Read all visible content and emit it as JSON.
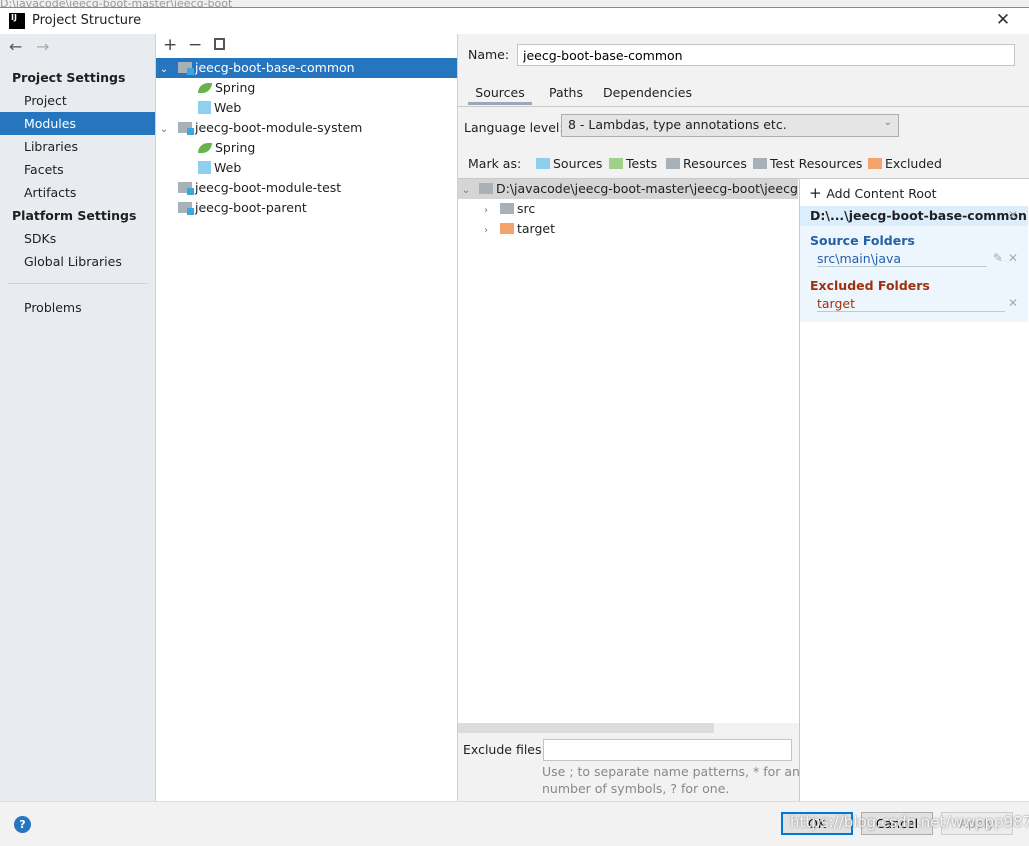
{
  "background_text": "D:\\javacode\\jeecg-boot-master\\jeecg-boot",
  "window": {
    "title": "Project Structure",
    "icon": "intellij-icon"
  },
  "sidebar": {
    "project_settings": "Project Settings",
    "items": [
      {
        "label": "Project"
      },
      {
        "label": "Modules",
        "selected": true
      },
      {
        "label": "Libraries"
      },
      {
        "label": "Facets"
      },
      {
        "label": "Artifacts"
      }
    ],
    "platform_settings": "Platform Settings",
    "platform_items": [
      {
        "label": "SDKs"
      },
      {
        "label": "Global Libraries"
      }
    ],
    "problems": "Problems"
  },
  "modules": [
    {
      "label": "jeecg-boot-base-common",
      "selected": true,
      "children": [
        {
          "label": "Spring",
          "icon": "spring-icon"
        },
        {
          "label": "Web",
          "icon": "web-icon"
        }
      ]
    },
    {
      "label": "jeecg-boot-module-system",
      "children": [
        {
          "label": "Spring",
          "icon": "spring-icon"
        },
        {
          "label": "Web",
          "icon": "web-icon"
        }
      ]
    },
    {
      "label": "jeecg-boot-module-test"
    },
    {
      "label": "jeecg-boot-parent"
    }
  ],
  "detail": {
    "name_label": "Name:",
    "name_value": "jeecg-boot-base-common",
    "tabs": [
      {
        "label": "Sources",
        "active": true
      },
      {
        "label": "Paths"
      },
      {
        "label": "Dependencies"
      }
    ],
    "language_level_label": "Language level:",
    "language_level": "8 - Lambdas, type annotations etc.",
    "mark_as": "Mark as:",
    "marks": [
      {
        "label": "Sources",
        "color": "#8fcfee"
      },
      {
        "label": "Tests",
        "color": "#9fd18b"
      },
      {
        "label": "Resources",
        "color": "#a9b1b8"
      },
      {
        "label": "Test Resources",
        "color": "#a9b1b8"
      },
      {
        "label": "Excluded",
        "color": "#f4a36f"
      }
    ],
    "root_path": "D:\\javacode\\jeecg-boot-master\\jeecg-boot\\jeecg-b",
    "folders": [
      {
        "label": "src",
        "color": "#a9b1b8"
      },
      {
        "label": "target",
        "color": "#f4a36f"
      }
    ],
    "add_content_root": "Add Content Root",
    "content_root": "D:\\...\\jeecg-boot-base-common",
    "source_folders_label": "Source Folders",
    "source_folder": "src\\main\\java",
    "excluded_folders_label": "Excluded Folders",
    "excluded_folder": "target",
    "exclude_files_label": "Exclude files:",
    "exclude_files_value": "",
    "hint1": "Use ; to separate name patterns, * for any",
    "hint2": "number of symbols, ? for one."
  },
  "buttons": {
    "ok": "OK",
    "cancel": "Cancel",
    "apply": "Apply"
  },
  "watermark": "https://blog.csdn.net/wwppp987"
}
